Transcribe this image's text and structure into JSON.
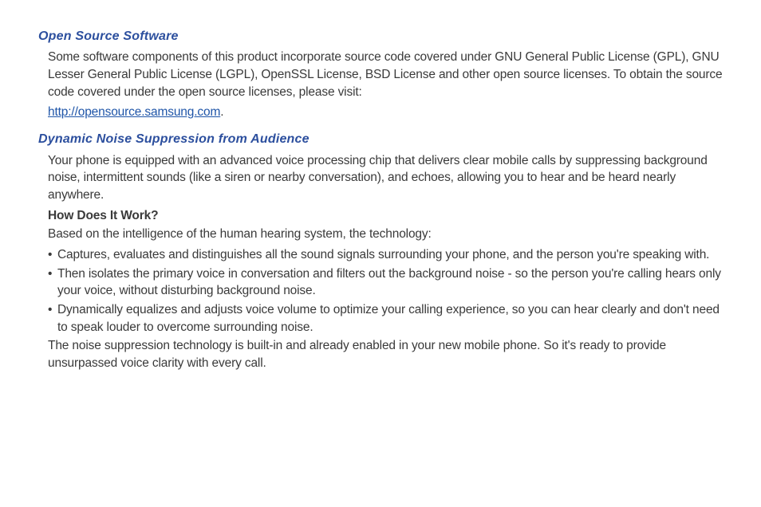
{
  "section1": {
    "heading": "Open Source Software",
    "para1": "Some software components of this product incorporate source code covered under GNU General Public License (GPL), GNU Lesser General Public License (LGPL), OpenSSL License, BSD License and other open source licenses. To obtain the source code covered under the open source licenses, please visit:",
    "link_text": "http://opensource.samsung.com",
    "link_period": "."
  },
  "section2": {
    "heading": "Dynamic Noise Suppression from Audience",
    "para1": "Your phone is equipped with an advanced voice processing chip that delivers clear mobile calls by suppressing background noise, intermittent sounds (like a siren or nearby conversation), and echoes, allowing you to hear and be heard nearly anywhere.",
    "subheading": "How Does It Work?",
    "para2": "Based on the intelligence of the human hearing system, the technology:",
    "bullets": [
      "Captures, evaluates and distinguishes all the sound signals surrounding your phone, and the person you're speaking with.",
      "Then isolates the primary voice in conversation and filters out the background noise - so the person you're calling hears only your voice, without disturbing background noise.",
      "Dynamically equalizes and adjusts voice volume to optimize your calling experience, so you can hear clearly and don't need to speak louder to overcome surrounding noise."
    ],
    "para3": "The noise suppression technology is built-in and already enabled in your new mobile phone.  So it's ready to provide unsurpassed voice clarity with every call."
  }
}
